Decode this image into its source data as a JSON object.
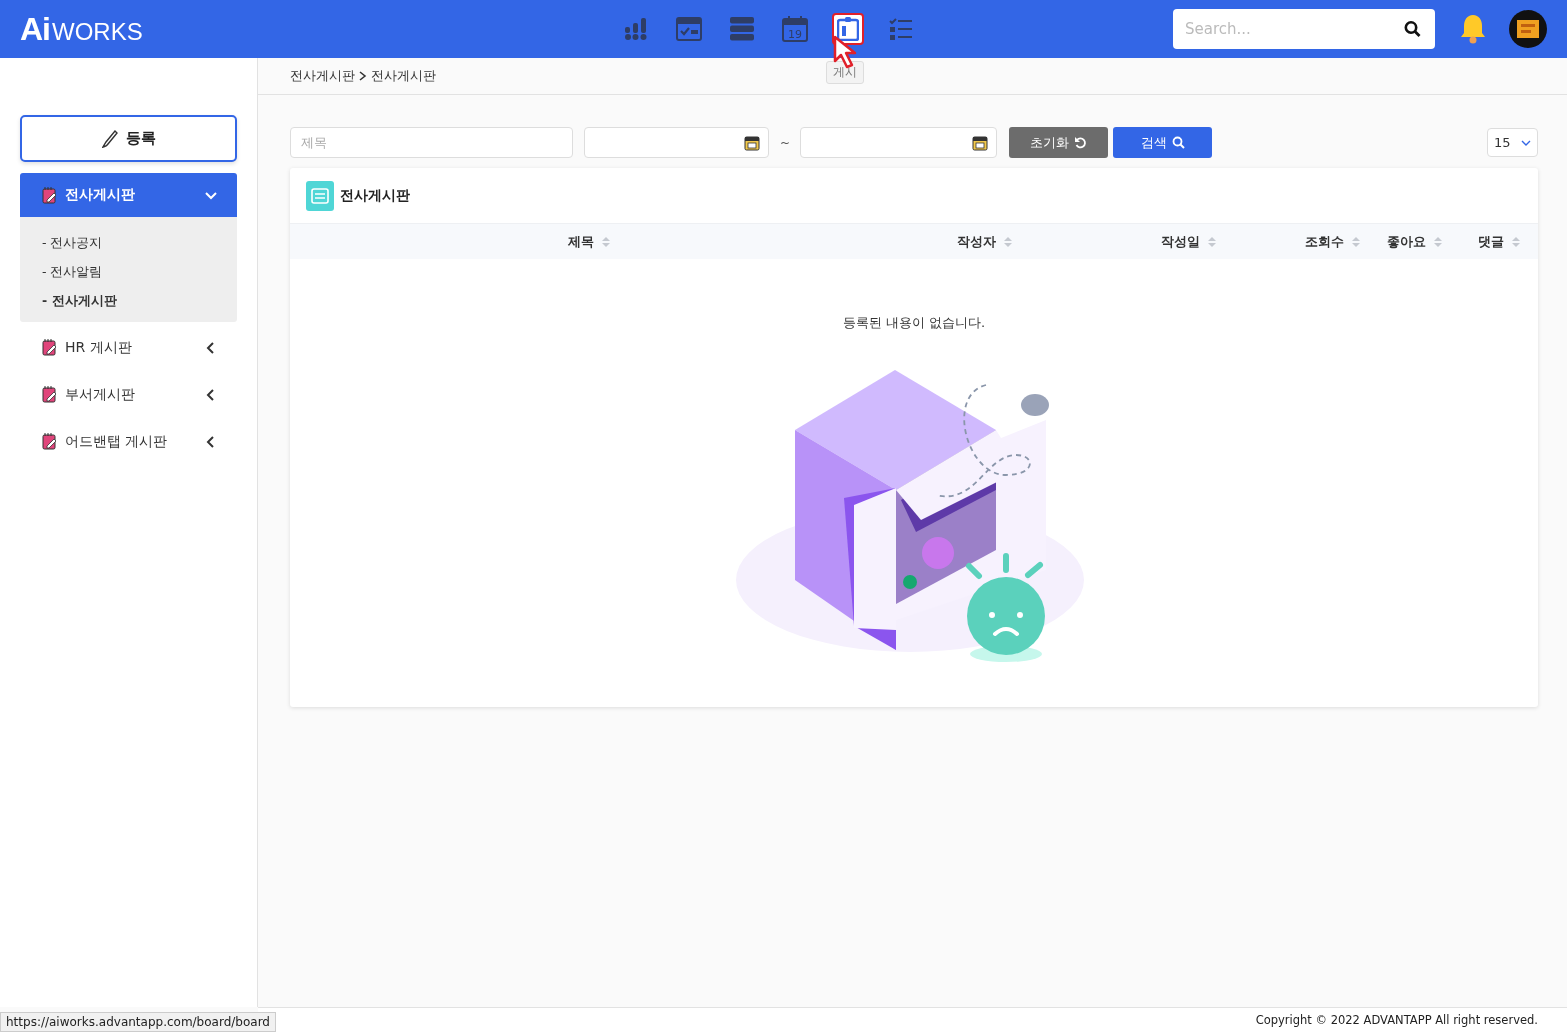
{
  "header": {
    "logo": {
      "mark": "Ai",
      "text": "WORKS"
    },
    "nav_icons": [
      {
        "kind": "chart",
        "selected": false
      },
      {
        "kind": "approval",
        "selected": false
      },
      {
        "kind": "server",
        "selected": false
      },
      {
        "kind": "calendar",
        "selected": false,
        "label": "19"
      },
      {
        "kind": "board",
        "selected": true
      },
      {
        "kind": "checklist",
        "selected": false
      }
    ],
    "tooltip": "게시",
    "search": {
      "placeholder": "Search..."
    }
  },
  "sidebar": {
    "register_button": "등록",
    "menu": [
      {
        "label": "전사게시판",
        "expanded": true,
        "children": [
          {
            "label": "- 전사공지",
            "selected": false
          },
          {
            "label": "- 전사알림",
            "selected": false
          },
          {
            "label": "- 전사게시판",
            "selected": true
          }
        ]
      },
      {
        "label": "HR 게시판",
        "expanded": false
      },
      {
        "label": "부서게시판",
        "expanded": false
      },
      {
        "label": "어드밴탭 게시판",
        "expanded": false
      }
    ]
  },
  "breadcrumb": [
    "전사게시판",
    "전사게시판"
  ],
  "filters": {
    "title_placeholder": "제목",
    "range_separator": "~",
    "reset_button": "초기화",
    "search_button": "검색",
    "page_size": "15"
  },
  "board": {
    "title": "전사게시판",
    "columns": [
      "제목",
      "작성자",
      "작성일",
      "조회수",
      "좋아요",
      "댓글"
    ],
    "empty_message": "등록된 내용이 없습니다."
  },
  "status_url": "https://aiworks.advantapp.com/board/board",
  "footer": "Copyright © 2022 ADVANTAPP All right reserved."
}
